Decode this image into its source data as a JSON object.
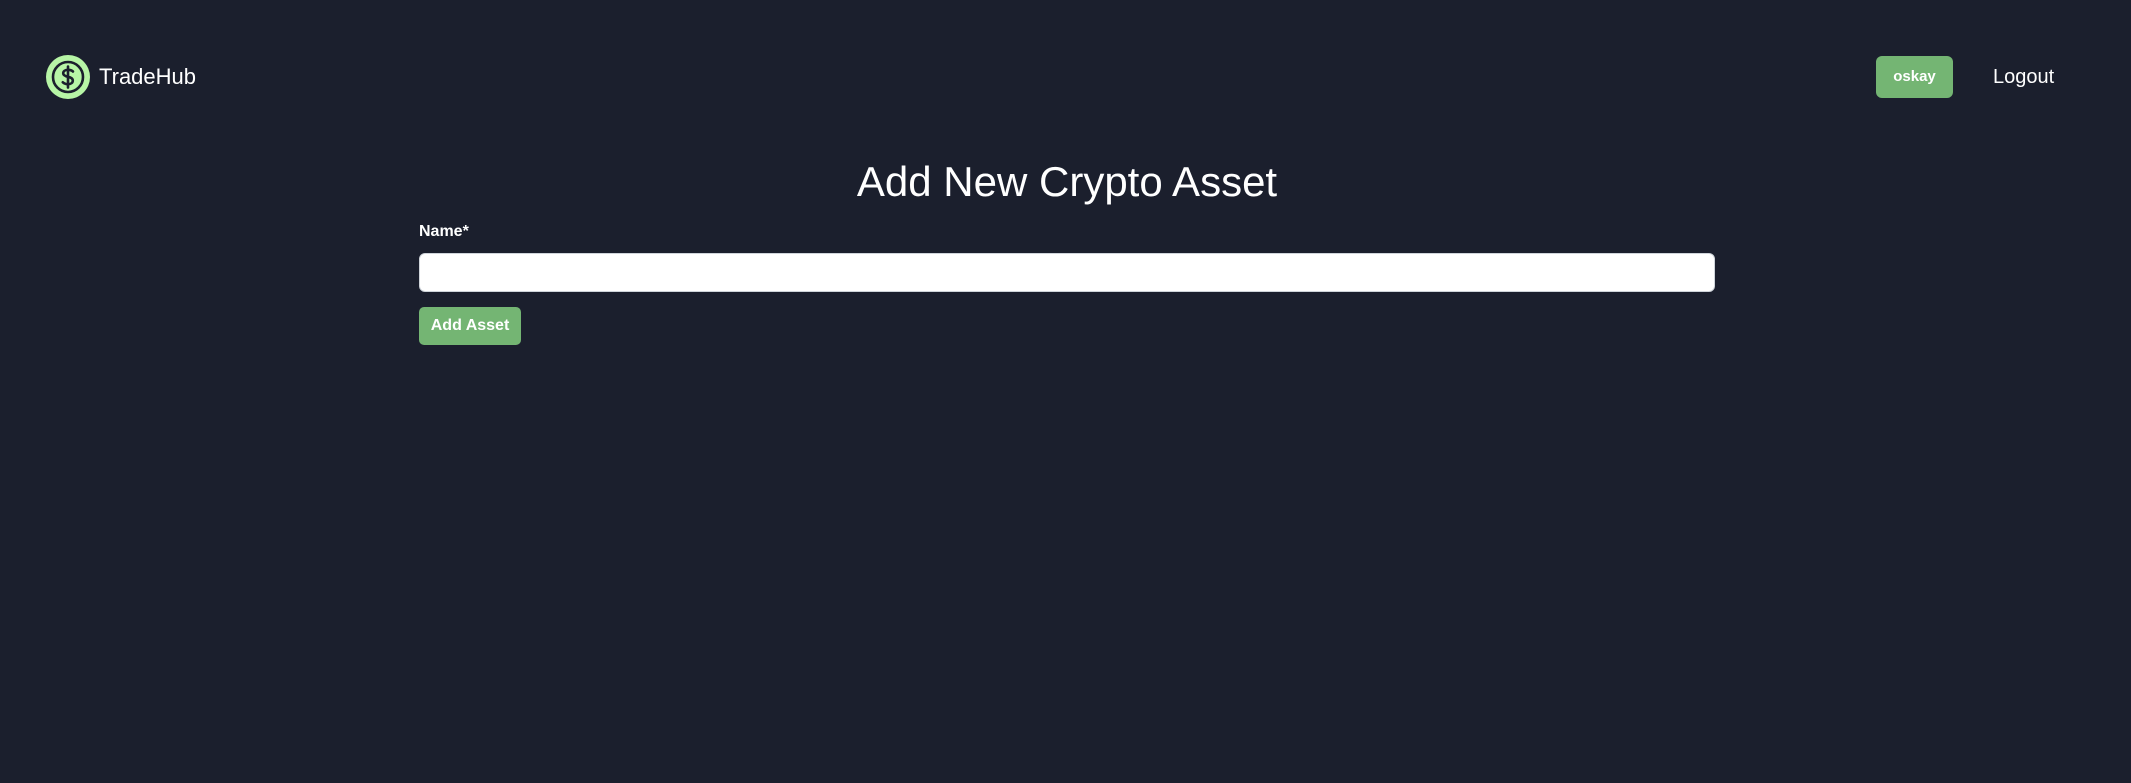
{
  "navbar": {
    "brand_name": "TradeHub",
    "brand_icon": "dollar-coin-icon",
    "username": "oskay",
    "logout_label": "Logout"
  },
  "main": {
    "title": "Add New Crypto Asset",
    "form": {
      "name_label": "Name*",
      "name_value": "",
      "name_placeholder": "",
      "submit_label": "Add Asset"
    }
  },
  "colors": {
    "background": "#1b1f2d",
    "accent": "#74b573",
    "logo_ring": "#b7f5a6",
    "text": "#ffffff"
  }
}
